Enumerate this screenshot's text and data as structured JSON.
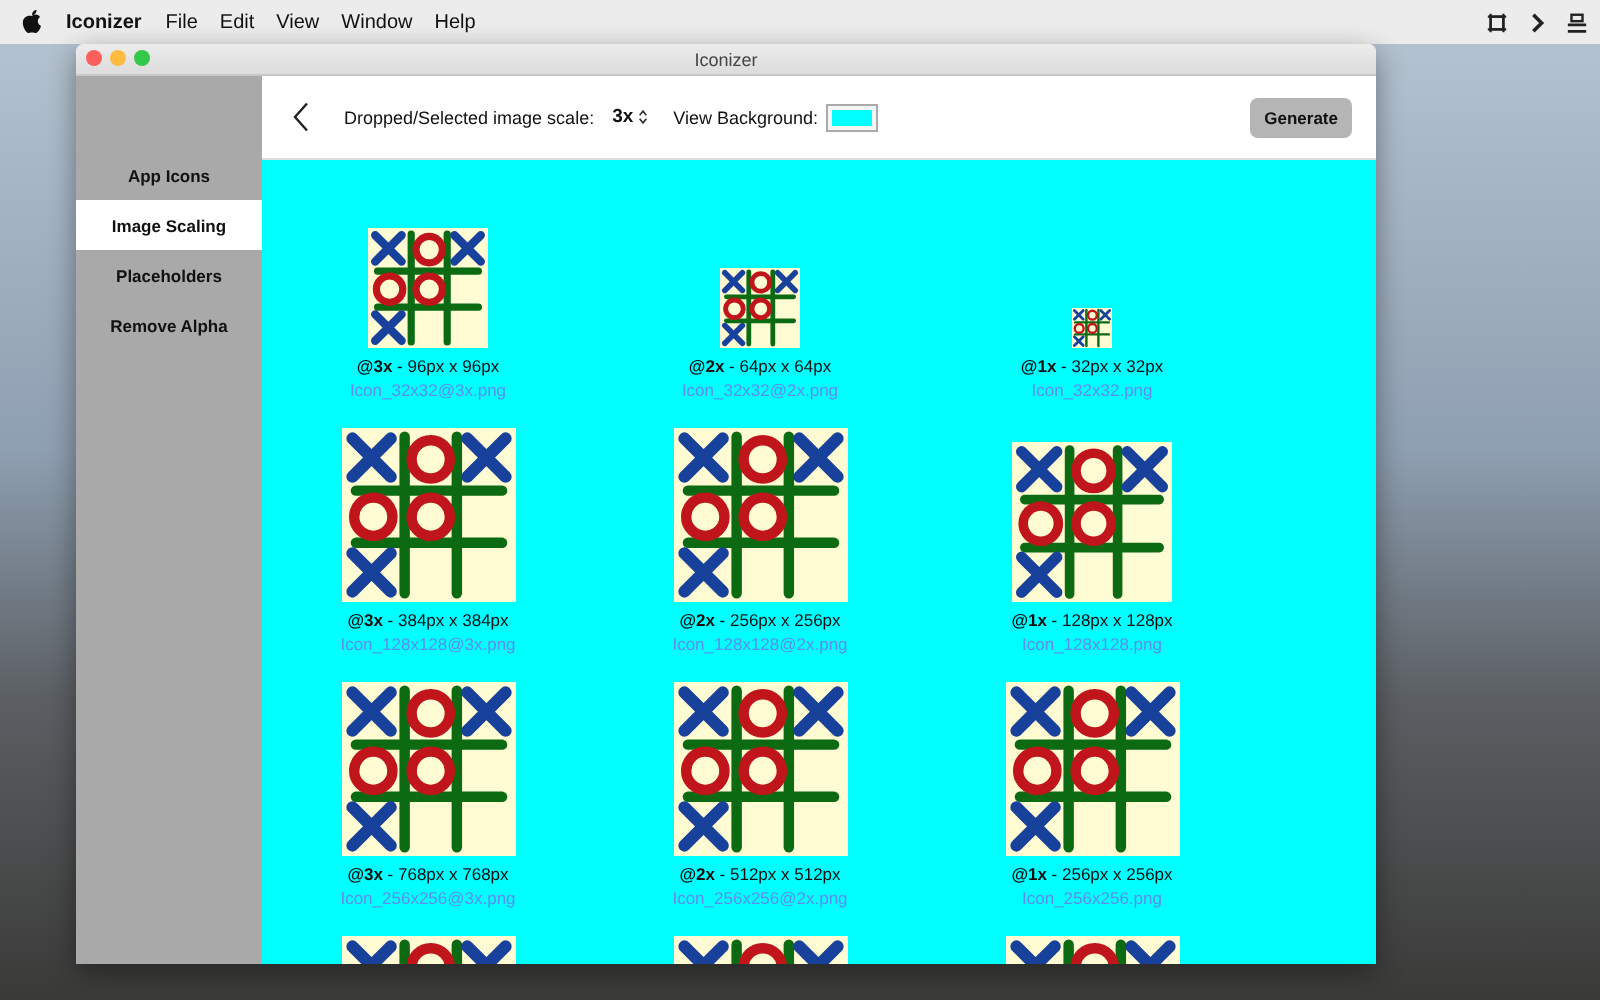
{
  "menu_bar": {
    "app_name": "Iconizer",
    "items": [
      "File",
      "Edit",
      "View",
      "Window",
      "Help"
    ]
  },
  "window": {
    "title": "Iconizer"
  },
  "sidebar": {
    "items": [
      {
        "label": "App Icons",
        "selected": false
      },
      {
        "label": "Image Scaling",
        "selected": true
      },
      {
        "label": "Placeholders",
        "selected": false
      },
      {
        "label": "Remove Alpha",
        "selected": false
      }
    ]
  },
  "toolbar": {
    "scale_label": "Dropped/Selected image scale:",
    "scale_value": "3x",
    "background_label": "View Background:",
    "generate_button": "Generate"
  },
  "images": {
    "rows": [
      {
        "items": [
          {
            "caption": "**@3x** - 96px x 96px",
            "filename": "Icon_32x32@3x.png"
          },
          {
            "caption": "**@2x** - 64px x 64px",
            "filename": "Icon_32x32@2x.png"
          },
          {
            "caption": "**@1x** - 32px x 32px",
            "filename": "Icon_32x32.png"
          }
        ]
      },
      {
        "items": [
          {
            "caption": "**@3x** - 384px x 384px",
            "filename": "Icon_128x128@3x.png"
          },
          {
            "caption": "**@2x** - 256px x 256px",
            "filename": "Icon_128x128@2x.png"
          },
          {
            "caption": "**@1x** - 128px x 128px",
            "filename": "Icon_128x128.png"
          }
        ]
      },
      {
        "items": [
          {
            "caption": "**@3x** - 768px x 768px",
            "filename": "Icon_256x256@3x.png"
          },
          {
            "caption": "**@2x** - 512px x 512px",
            "filename": "Icon_256x256@2x.png"
          },
          {
            "caption": "**@1x** - 256px x 256px",
            "filename": "Icon_256x256.png"
          }
        ]
      }
    ]
  }
}
